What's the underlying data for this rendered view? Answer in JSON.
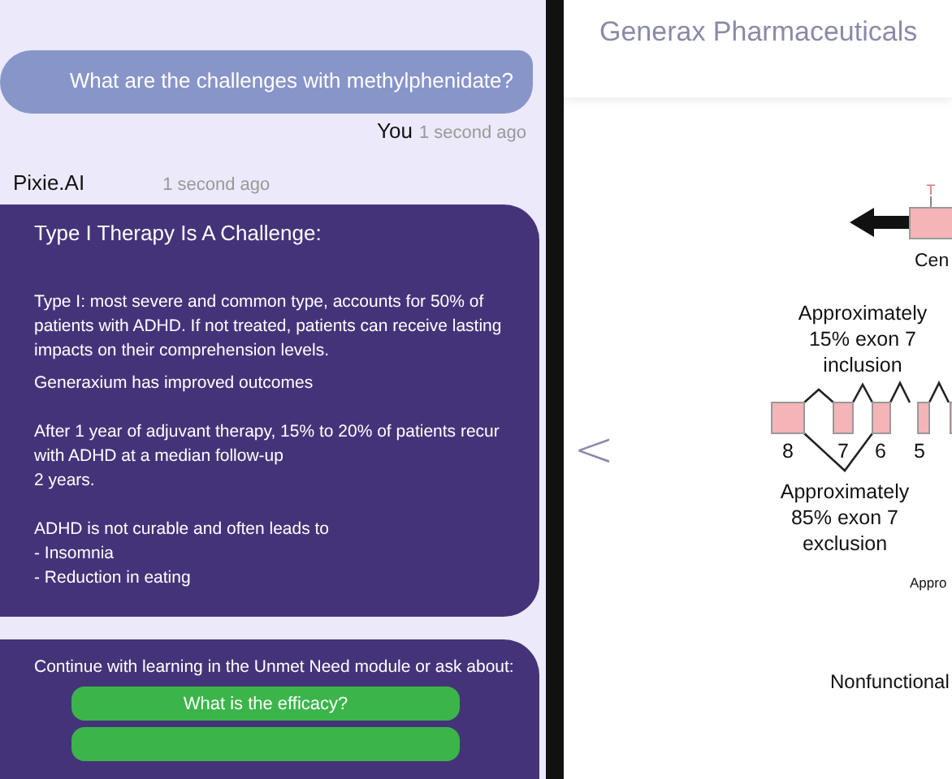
{
  "chat": {
    "question": {
      "text": "What are the challenges with methylphenidate?",
      "author": "You",
      "time": "1 second ago"
    },
    "reply": {
      "author": "Pixie.AI",
      "time": "1 second ago",
      "title": "Type I Therapy Is A Challenge:",
      "paragraphs": [
        {
          "kind": "text",
          "text": "Type I: most severe and common type, accounts for 50% of patients with ADHD. If not treated, patients can receive lasting impacts on their comprehension levels."
        },
        {
          "kind": "tight",
          "text": "Generaxium has improved outcomes"
        },
        {
          "kind": "text",
          "text": "After 1 year of adjuvant therapy, 15% to 20% of patients recur with ADHD at a median follow-up\n2 years."
        },
        {
          "kind": "text",
          "text": "ADHD is not curable and often leads to"
        },
        {
          "kind": "bullet",
          "text": "-  Insomnia"
        },
        {
          "kind": "bullet",
          "text": "-  Reduction in eating"
        }
      ]
    },
    "followup": {
      "text": "Continue with learning in the Unmet Need module or ask about:",
      "options": [
        {
          "kind": "labeled",
          "label": "What is the efficacy?"
        },
        {
          "kind": "cut"
        }
      ]
    }
  },
  "viewer": {
    "title": "Generax Pharmaceuticals",
    "prev": "<",
    "diagram": {
      "marker": "T",
      "gene_label": "Cen",
      "inclusion": [
        "Approximately",
        "15% exon 7",
        "inclusion"
      ],
      "exons": [
        "8",
        "7",
        "6",
        "5"
      ],
      "exclusion": [
        "Approximately",
        "85% exon 7",
        "exclusion"
      ],
      "side_label": "Appro",
      "product_label": "Nonfunctional"
    }
  }
}
